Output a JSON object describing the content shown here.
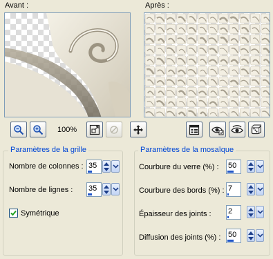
{
  "previews": {
    "before_label": "Avant :",
    "after_label": "Après :"
  },
  "toolbar": {
    "zoom_level": "100%",
    "icons": [
      "zoom-out-icon",
      "zoom-in-icon",
      "fit-to-window-icon",
      "preview-disabled-icon",
      "pan-icon",
      "preset-icon",
      "eye-proof-icon",
      "eye-preview-icon",
      "dice-random-icon"
    ]
  },
  "grid_params": {
    "title": "Paramètres de la grille",
    "columns_label": "Nombre de colonnes :",
    "columns_value": "35",
    "columns_fraction": 0.35,
    "rows_label": "Nombre de lignes :",
    "rows_value": "35",
    "rows_fraction": 0.35,
    "symmetric_label": "Symétrique",
    "symmetric_checked": true
  },
  "mosaic_params": {
    "title": "Paramètres de la mosaïque",
    "glass_curvature_label": "Courbure du verre (%) :",
    "glass_curvature_value": "50",
    "glass_curvature_fraction": 0.5,
    "edge_curvature_label": "Courbure des bords (%) :",
    "edge_curvature_value": "7",
    "edge_curvature_fraction": 0.07,
    "joint_thickness_label": "Épaisseur des joints :",
    "joint_thickness_value": "2",
    "joint_thickness_fraction": 0.1,
    "joint_diffusion_label": "Diffusion des joints (%) :",
    "joint_diffusion_value": "50",
    "joint_diffusion_fraction": 0.5
  },
  "colors": {
    "accent": "#0046d5",
    "window_bg": "#ece9d8",
    "sepia_light": "#f3efe3",
    "sepia_dark": "#8d8574"
  }
}
